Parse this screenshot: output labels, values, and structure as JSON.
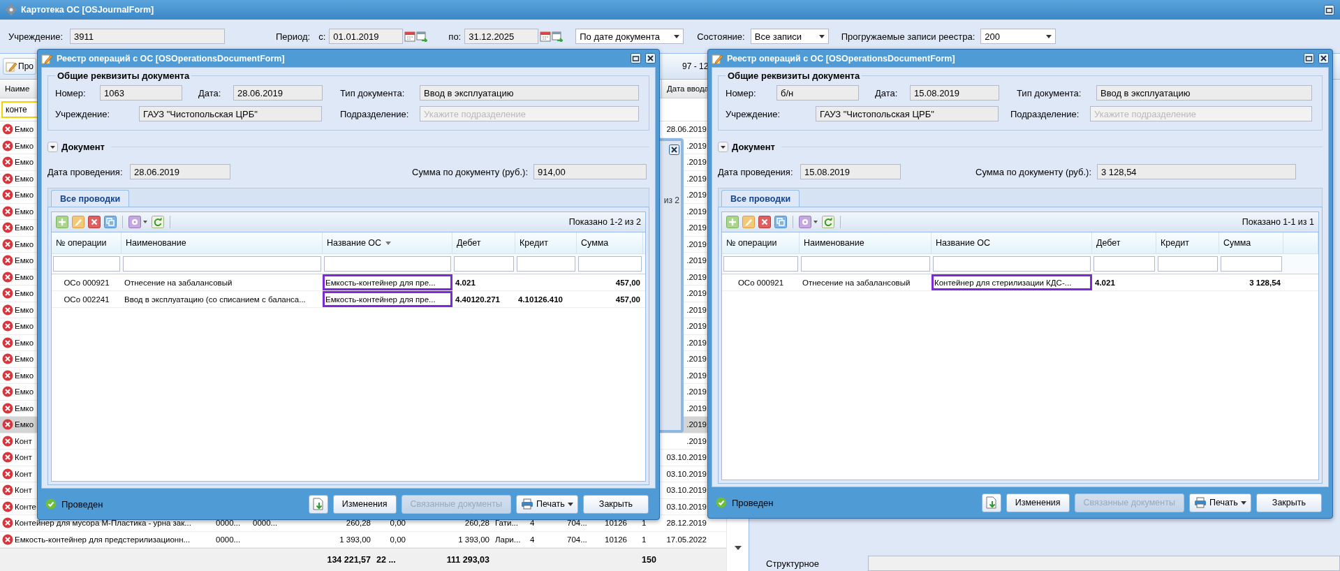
{
  "window": {
    "title": "Картотека ОС [OSJournalForm]"
  },
  "filter_bar": {
    "institution": {
      "label": "Учреждение:",
      "value": "3911"
    },
    "period": {
      "label": "Период:",
      "from_label": "с:",
      "from": "01.01.2019",
      "to_label": "по:",
      "to": "31.12.2025"
    },
    "date_basis": {
      "value": "По дате документа"
    },
    "state": {
      "label": "Состояние:",
      "value": "Все записи"
    },
    "load_limit": {
      "label": "Прогружаемые записи реестра:",
      "value": "200"
    }
  },
  "toolbar": {
    "button_label": "Про",
    "paging": "97 - 12"
  },
  "grid": {
    "name_header": "Наиме",
    "date_header": "Дата ввода",
    "search_value": "конте",
    "rows": [
      {
        "name": "Емко",
        "date": "28.06.2019",
        "selected": false
      },
      {
        "name": "Емко",
        "date": ".2019",
        "selected": false
      },
      {
        "name": "Емко",
        "date": ".2019",
        "selected": false
      },
      {
        "name": "Емко",
        "date": ".2019",
        "selected": false
      },
      {
        "name": "Емко",
        "date": ".2019",
        "selected": false
      },
      {
        "name": "Емко",
        "date": ".2019",
        "selected": false
      },
      {
        "name": "Емко",
        "date": ".2019",
        "selected": false
      },
      {
        "name": "Емко",
        "date": ".2019",
        "selected": false
      },
      {
        "name": "Емко",
        "date": ".2019",
        "selected": false
      },
      {
        "name": "Емко",
        "date": ".2019",
        "selected": false
      },
      {
        "name": "Емко",
        "date": ".2019",
        "selected": false
      },
      {
        "name": "Емко",
        "date": ".2019",
        "selected": false
      },
      {
        "name": "Емко",
        "date": ".2019",
        "selected": false
      },
      {
        "name": "Емко",
        "date": ".2019",
        "selected": false
      },
      {
        "name": "Емко",
        "date": ".2019",
        "selected": false
      },
      {
        "name": "Емко",
        "date": ".2019",
        "selected": false
      },
      {
        "name": "Емко",
        "date": ".2019",
        "selected": false
      },
      {
        "name": "Емко",
        "date": ".2019",
        "selected": false
      },
      {
        "name": "Емко",
        "date": ".2019",
        "selected": true
      },
      {
        "name": "Конт",
        "date": ".2019",
        "selected": false
      },
      {
        "name": "Конт",
        "date": "03.10.2019",
        "selected": false
      },
      {
        "name": "Конт",
        "date": "03.10.2019",
        "selected": false
      },
      {
        "name": "Конт",
        "date": "03.10.2019",
        "selected": false
      },
      {
        "name": "Конте",
        "date": "03.10.2019",
        "selected": false
      },
      {
        "name": "Контейнер для мусора М-Пластика - урна зак...",
        "column_2": "0000...",
        "column_3": "0000...",
        "column_4": "260,28",
        "column_5": "0,00",
        "column_6": "260,28",
        "column_7": "Гати...",
        "column_8": "4",
        "column_9": "704...",
        "column_10": "10126",
        "column_11": "1",
        "date": "28.12.2019",
        "selected": false
      },
      {
        "name": "Емкость-контейнер для предстерилизационн...",
        "column_2": "0000...",
        "column_4": "1 393,00",
        "column_5": "0,00",
        "column_6": "1 393,00",
        "column_7": "Лари...",
        "column_8": "4",
        "column_9": "704...",
        "column_10": "10126",
        "column_11": "1",
        "date": "17.05.2022",
        "selected": false
      }
    ],
    "totals": {
      "column_4": "134 221,57",
      "column_5": "22 ...",
      "column_6": "111 293,03",
      "column_11": "150"
    }
  },
  "side_panel": {
    "label": "Структурное"
  },
  "background_dialog": {
    "paging": "из 2"
  },
  "dialogs": [
    {
      "title": "Реестр операций с ОС [OSOperationsDocumentForm]",
      "details": {
        "legend": "Общие реквизиты документа",
        "number": {
          "label": "Номер:",
          "value": "1063"
        },
        "date": {
          "label": "Дата:",
          "value": "28.06.2019"
        },
        "doc_type": {
          "label": "Тип документа:",
          "value": "Ввод в эксплуатацию"
        },
        "institution": {
          "label": "Учреждение:",
          "value": "ГАУЗ \"Чистопольская ЦРБ\""
        },
        "department": {
          "label": "Подразделение:",
          "placeholder": "Укажите подразделение"
        }
      },
      "document_section": {
        "title": "Документ",
        "expanded": true
      },
      "posting_date": {
        "label": "Дата проведения:",
        "value": "28.06.2019"
      },
      "total": {
        "label": "Сумма по документу (руб.):",
        "value": "914,00"
      },
      "tabs": [
        {
          "label": "Все проводки",
          "selected": true
        }
      ],
      "paging": "Показано 1-2 из 2",
      "columns": [
        {
          "label": "№ операции",
          "sorted": false
        },
        {
          "label": "Наименование",
          "sorted": false
        },
        {
          "label": "Название ОС",
          "sorted": true
        },
        {
          "label": "Дебет",
          "sorted": false
        },
        {
          "label": "Кредит",
          "sorted": false
        },
        {
          "label": "Сумма",
          "sorted": false
        }
      ],
      "rows": [
        {
          "operation": "ОСо 000921",
          "name": "Отнесение на забалансовый",
          "asset": "Емкость-контейнер для пре...",
          "asset_highlighted": true,
          "debit": "4.021",
          "sum": "457,00"
        },
        {
          "operation": "ОСо 002241",
          "name": "Ввод в эксплуатацию (со списанием с баланса...",
          "asset": "Емкость-контейнер для пре...",
          "asset_highlighted": true,
          "debit": "4.40120.271",
          "credit": "4.10126.410",
          "sum": "457,00"
        }
      ],
      "status": "Проведен",
      "buttons": [
        {
          "kind": "icon",
          "disabled": false
        },
        {
          "kind": "text",
          "label": "Изменения",
          "disabled": false
        },
        {
          "kind": "text",
          "label": "Связанные документы",
          "disabled": true
        },
        {
          "kind": "menu",
          "label": "Печать",
          "disabled": false
        },
        {
          "kind": "text",
          "label": "Закрыть",
          "disabled": false
        }
      ]
    },
    {
      "title": "Реестр операций с ОС [OSOperationsDocumentForm]",
      "details": {
        "legend": "Общие реквизиты документа",
        "number": {
          "label": "Номер:",
          "value": "б/н"
        },
        "date": {
          "label": "Дата:",
          "value": "15.08.2019"
        },
        "doc_type": {
          "label": "Тип документа:",
          "value": "Ввод в эксплуатацию"
        },
        "institution": {
          "label": "Учреждение:",
          "value": "ГАУЗ \"Чистопольская ЦРБ\""
        },
        "department": {
          "label": "Подразделение:",
          "placeholder": "Укажите подразделение"
        }
      },
      "document_section": {
        "title": "Документ",
        "expanded": true
      },
      "posting_date": {
        "label": "Дата проведения:",
        "value": "15.08.2019"
      },
      "total": {
        "label": "Сумма по документу (руб.):",
        "value": "3 128,54"
      },
      "tabs": [
        {
          "label": "Все проводки",
          "selected": true
        }
      ],
      "paging": "Показано 1-1 из 1",
      "columns": [
        {
          "label": "№ операции",
          "sorted": false
        },
        {
          "label": "Наименование",
          "sorted": false
        },
        {
          "label": "Название ОС",
          "sorted": false
        },
        {
          "label": "Дебет",
          "sorted": false
        },
        {
          "label": "Кредит",
          "sorted": false
        },
        {
          "label": "Сумма",
          "sorted": false
        }
      ],
      "rows": [
        {
          "operation": "ОСо 000921",
          "name": "Отнесение на забалансовый",
          "asset": "Контейнер для стерилизации КДС-...",
          "asset_highlighted": true,
          "debit": "4.021",
          "sum": "3 128,54"
        }
      ],
      "status": "Проведен",
      "buttons": [
        {
          "kind": "icon",
          "disabled": false
        },
        {
          "kind": "text",
          "label": "Изменения",
          "disabled": false
        },
        {
          "kind": "text",
          "label": "Связанные документы",
          "disabled": true
        },
        {
          "kind": "menu",
          "label": "Печать",
          "disabled": false
        },
        {
          "kind": "text",
          "label": "Закрыть",
          "disabled": false
        }
      ]
    }
  ]
}
